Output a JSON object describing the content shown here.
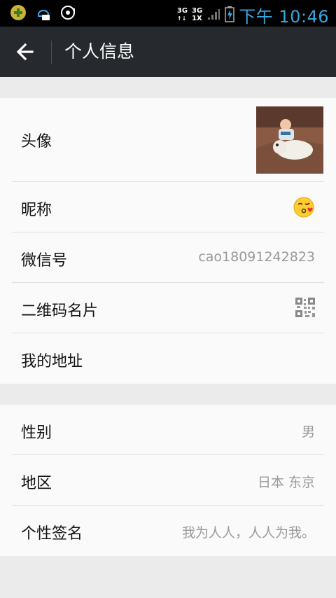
{
  "status_bar": {
    "net1": "3G",
    "net2": "3G",
    "net3": "1X",
    "time": "下午 10:46"
  },
  "nav": {
    "title": "个人信息"
  },
  "profile": {
    "avatar_label": "头像",
    "nickname_label": "昵称",
    "wechat_id_label": "微信号",
    "wechat_id_value": "cao18091242823",
    "qr_label": "二维码名片",
    "address_label": "我的地址"
  },
  "details": {
    "gender_label": "性别",
    "gender_value": "男",
    "region_label": "地区",
    "region_value": "日本 东京",
    "signature_label": "个性签名",
    "signature_value": "我为人人，人人为我。"
  },
  "icons": {
    "back": "arrow-left-icon",
    "nickname_emoji": "kissing-face-icon",
    "qr": "qr-code-icon"
  },
  "colors": {
    "navbar": "#26292d",
    "clock": "#35a8e0",
    "page_bg": "#ebebeb"
  }
}
